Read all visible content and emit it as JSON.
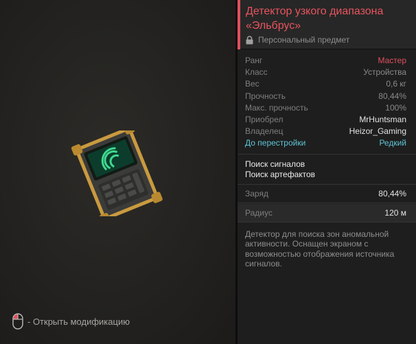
{
  "item": {
    "title": "Детектор узкого диапазона «Эльбрус»",
    "subtitle": "Персональный предмет",
    "lock_icon": "lock-icon"
  },
  "stats": [
    {
      "label": "Ранг",
      "value": "Мастер"
    },
    {
      "label": "Класс",
      "value": "Устройства"
    },
    {
      "label": "Вес",
      "value": "0,6 кг"
    },
    {
      "label": "Прочность",
      "value": "80,44%"
    },
    {
      "label": "Макс. прочность",
      "value": "100%"
    },
    {
      "label": "Приобрел",
      "value": "MrHuntsman"
    },
    {
      "label": "Владелец",
      "value": "Heizor_Gaming"
    },
    {
      "label": "До перестройки",
      "value": "Редкий"
    }
  ],
  "features": [
    "Поиск сигналов",
    "Поиск артефактов"
  ],
  "charge": {
    "label": "Заряд",
    "value": "80,44%"
  },
  "radius": {
    "label": "Радиус",
    "value": "120 м"
  },
  "description": "Детектор для поиска зон аномальной активности. Оснащен экраном с возможностью отображения источника сигналов.",
  "hint": {
    "text": "- Открыть модификацию",
    "icon": "mouse-icon"
  },
  "colors": {
    "accent": "#e0505e",
    "rank": "#e0505e",
    "rebuild": "#5fc5d6",
    "screen": "#3fd88f"
  }
}
